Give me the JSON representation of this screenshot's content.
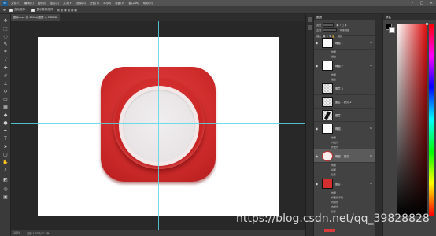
{
  "menu": {
    "logo": "Ps",
    "items": [
      "文件(F)",
      "编辑(E)",
      "图像(I)",
      "图层(L)",
      "文字(Y)",
      "选择(S)",
      "滤镜(T)",
      "3D(D)",
      "视图(V)",
      "窗口(W)",
      "帮助(H)"
    ]
  },
  "options": {
    "auto_select": "自动选择：",
    "show_transform": "显示变换控件"
  },
  "document": {
    "tab_title": "图标.psd @ 100%(图层 4, RGB/8)"
  },
  "layers_panel": {
    "tab": "图层",
    "kind_label": "类型",
    "blend_label": "正常",
    "opacity_label": "不透明度",
    "lock_label": "锁定",
    "fill_label": "填充",
    "layers": [
      {
        "name": "椭圆 1",
        "thumb": "white",
        "fx": "fx",
        "effects": [
          "效果",
          "描边"
        ]
      },
      {
        "name": "椭圆 2",
        "thumb": "white",
        "fx": "fx",
        "effects": [
          "效果",
          "描边"
        ]
      },
      {
        "name": "图层 3",
        "thumb": "check",
        "fx": "",
        "effects": []
      },
      {
        "name": "图层 1 拷贝 2",
        "thumb": "check",
        "fx": "",
        "effects": []
      },
      {
        "name": "图层 1",
        "thumb": "stroke",
        "fx": "",
        "effects": []
      },
      {
        "name": "椭圆 1",
        "thumb": "white",
        "fx": "fx",
        "effects": [
          "效果",
          "内发光",
          "外发光"
        ]
      },
      {
        "name": "椭圆 1 拷贝",
        "thumb": "ring",
        "fx": "fx",
        "effects": [
          "效果",
          "斜面",
          "投影"
        ]
      },
      {
        "name": "图层 1",
        "thumb": "red",
        "fx": "fx",
        "effects": [
          "效果",
          "斜面和浮雕",
          "内阴影",
          "内发光",
          "投影"
        ]
      }
    ]
  },
  "color_panel": {
    "tab": "颜色",
    "foreground": "#000000",
    "background": "#ffffff",
    "hue_color": "#e01010"
  },
  "status": {
    "zoom": "100%",
    "doc_size": "文档:1.37M/22.7M"
  },
  "canvas": {
    "icon_color": "#d63232",
    "disc_color": "#e8e4e6"
  },
  "watermark": "https://blog.csdn.net/qq_39828828"
}
